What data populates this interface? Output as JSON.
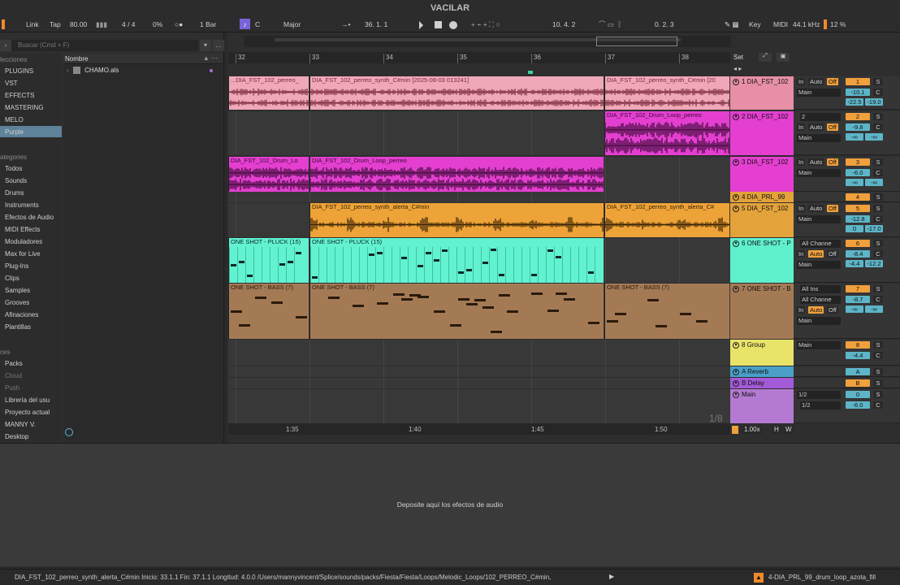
{
  "window": {
    "title": "VACILAR"
  },
  "transport": {
    "link": "Link",
    "tap": "Tap",
    "tempo": "80.00",
    "meter": "4 / 4",
    "swing": "0%",
    "quantize": "1 Bar",
    "key": "C",
    "scale": "Major",
    "position": "36.  1.  1",
    "loop_start": "10.  4.  2",
    "loop_len": "0.  2.  3",
    "key_map": "Key",
    "midi_map": "MIDI",
    "sample_rate": "44.1 kHz",
    "cpu": "12 %"
  },
  "browser": {
    "search_placeholder": "Buscar (Cmd + F)",
    "collections_header": "lecciones",
    "collections": [
      "PLUGINS",
      "VST",
      "EFFECTS",
      "MASTERING",
      "MELO",
      "Purple"
    ],
    "categories_header": "ategories",
    "categories": [
      "Todos",
      "Sounds",
      "Drums",
      "Instruments",
      "Efectos de Audio",
      "MIDI Effects",
      "Moduladores",
      "Max for Live",
      "Plug-Ins",
      "Clips",
      "Samples",
      "Grooves",
      "Afinaciones",
      "Plantillas"
    ],
    "places_header": "ces",
    "places": [
      "Packs",
      "Cloud",
      "Push",
      "Librería del usu",
      "Proyecto actual",
      "MANNY V.",
      "Desktop"
    ],
    "file_column": "Nombre",
    "files": [
      "CHAMO.als"
    ]
  },
  "ruler": {
    "bars": [
      "32",
      "33",
      "34",
      "35",
      "36",
      "37",
      "38"
    ],
    "times": [
      "1:35",
      "1:40",
      "1:45",
      "1:50"
    ]
  },
  "arrangement": {
    "set_label": "Set",
    "zoom_label": "1/8"
  },
  "tracks": [
    {
      "name": "1 DIA_FST_102",
      "color": "#e68fa6",
      "clips": [
        "...DIA_FST_102_perreo_",
        "DIA_FST_102_perreo_synth_C#min [2025-08-03 013241]",
        "DIA_FST_102_perreo_synth_C#min [20"
      ],
      "input": "In",
      "auto": "Auto",
      "off": "Off",
      "route": "Main",
      "num": "1",
      "vol": "-10.1",
      "pan_l": "-22.5",
      "pan_r": "-19.0"
    },
    {
      "name": "2 DIA_FST_102",
      "color": "#e43fd0",
      "clips": [
        "DIA_FST_102_Drum_Loop_perreo"
      ],
      "input": "In",
      "auto": "Auto",
      "off": "Off",
      "route": "Main",
      "num": "2",
      "vol": "-9.8",
      "in_ch": "2",
      "pan_l": "-∞",
      "pan_r": "-∞"
    },
    {
      "name": "3 DIA_FST_102",
      "color": "#e43fd0",
      "clips": [
        "DIA_FST_102_Drum_Lo",
        "DIA_FST_102_Drum_Loop_perreo"
      ],
      "input": "In",
      "auto": "Auto",
      "off": "Off",
      "route": "Main",
      "num": "3",
      "vol": "-6.0",
      "pan_l": "-∞",
      "pan_r": "-∞"
    },
    {
      "name": "4 DIA_PRL_99",
      "color": "#e3a23a",
      "clips": [],
      "num": "4"
    },
    {
      "name": "5 DIA_FST_102",
      "color": "#e3a23a",
      "clips": [
        "DIA_FST_102_perreo_synth_alerta_C#min",
        "DIA_FST_102_perreo_synth_alerta_C#"
      ],
      "input": "In",
      "auto": "Auto",
      "off": "Off",
      "route": "Main",
      "num": "5",
      "vol": "-12.8",
      "pan_l": "0",
      "pan_r": "-17.0"
    },
    {
      "name": "6 ONE SHOT - P",
      "color": "#5ff0cc",
      "clips": [
        "ONE SHOT - PLUCK (15)",
        "ONE SHOT - PLUCK (15)"
      ],
      "input": "In",
      "auto": "Auto",
      "off": "Off",
      "route": "Main",
      "num": "6",
      "vol": "-8.4",
      "in_ch": "All Channe",
      "pan_l": "-4.4",
      "pan_r": "-12.2"
    },
    {
      "name": "7 ONE SHOT - B",
      "color": "#a47a55",
      "clips": [
        "ONE SHOT - BASS  (7)",
        "ONE SHOT - BASS  (7)",
        "ONE SHOT - BASS  (7)"
      ],
      "input": "In",
      "auto": "Auto",
      "off": "Off",
      "route": "Main",
      "num": "7",
      "vol": "-8.7",
      "in_ch": "All Ins",
      "in_sub": "All Channe",
      "pan_l": "-∞",
      "pan_r": "-∞"
    },
    {
      "name": "8 Group",
      "color": "#e9e36a",
      "clips": [],
      "route": "Main",
      "num": "8",
      "vol": "-4.4"
    },
    {
      "name": "A Reverb",
      "color": "#4aa0c8",
      "clips": [],
      "num": "A"
    },
    {
      "name": "B Delay",
      "color": "#a35ad8",
      "clips": [],
      "num": "B"
    },
    {
      "name": "Main",
      "color": "#b47ad1",
      "clips": [],
      "num": "0",
      "vol": "-6.0",
      "route": "1/2",
      "route2": "1/2"
    }
  ],
  "bottom": {
    "drop_text": "Deposite aquí los efectos de audio"
  },
  "status": {
    "text": "DIA_FST_102_perreo_synth_alerta_C#min  Inicio: 33.1.1  Fin: 37.1.1  Longitud: 4.0.0  /Users/mannyvincent/Splice/sounds/packs/Fiesta/Fiesta/Loops/Melodic_Loops/102_PERREO_C#min,",
    "right": "4-DIA_PRL_99_drum_loop_azota_fill"
  },
  "zoom": {
    "value": "1.00x",
    "h": "H",
    "w": "W"
  }
}
